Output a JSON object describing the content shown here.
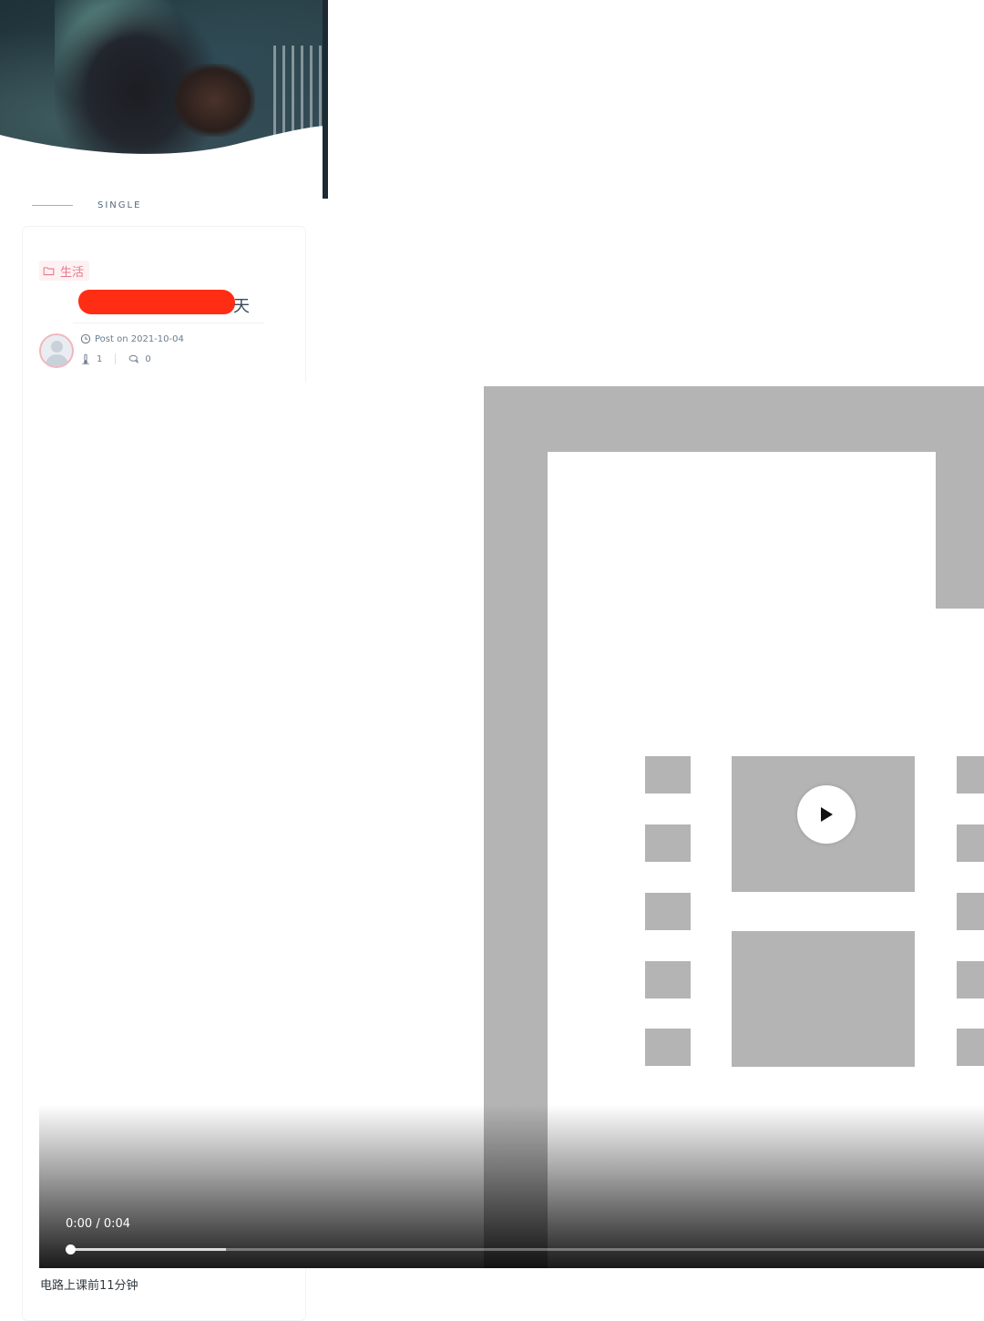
{
  "section": {
    "label": "SINGLE"
  },
  "post": {
    "category": "生活",
    "title_visible_suffix": "天",
    "date": "Post on 2021-10-04",
    "views": "1",
    "comments": "0"
  },
  "video": {
    "time": "0:00 / 0:04",
    "progress_fraction": 0.0,
    "buffered_fraction": 0.17
  },
  "caption": "电路上课前11分钟",
  "icons": [
    "folder-icon",
    "clock-icon",
    "thermometer-icon",
    "comment-icon",
    "play-icon"
  ],
  "colors": {
    "accent": "#e8788b",
    "redaction": "#ff2d14"
  }
}
